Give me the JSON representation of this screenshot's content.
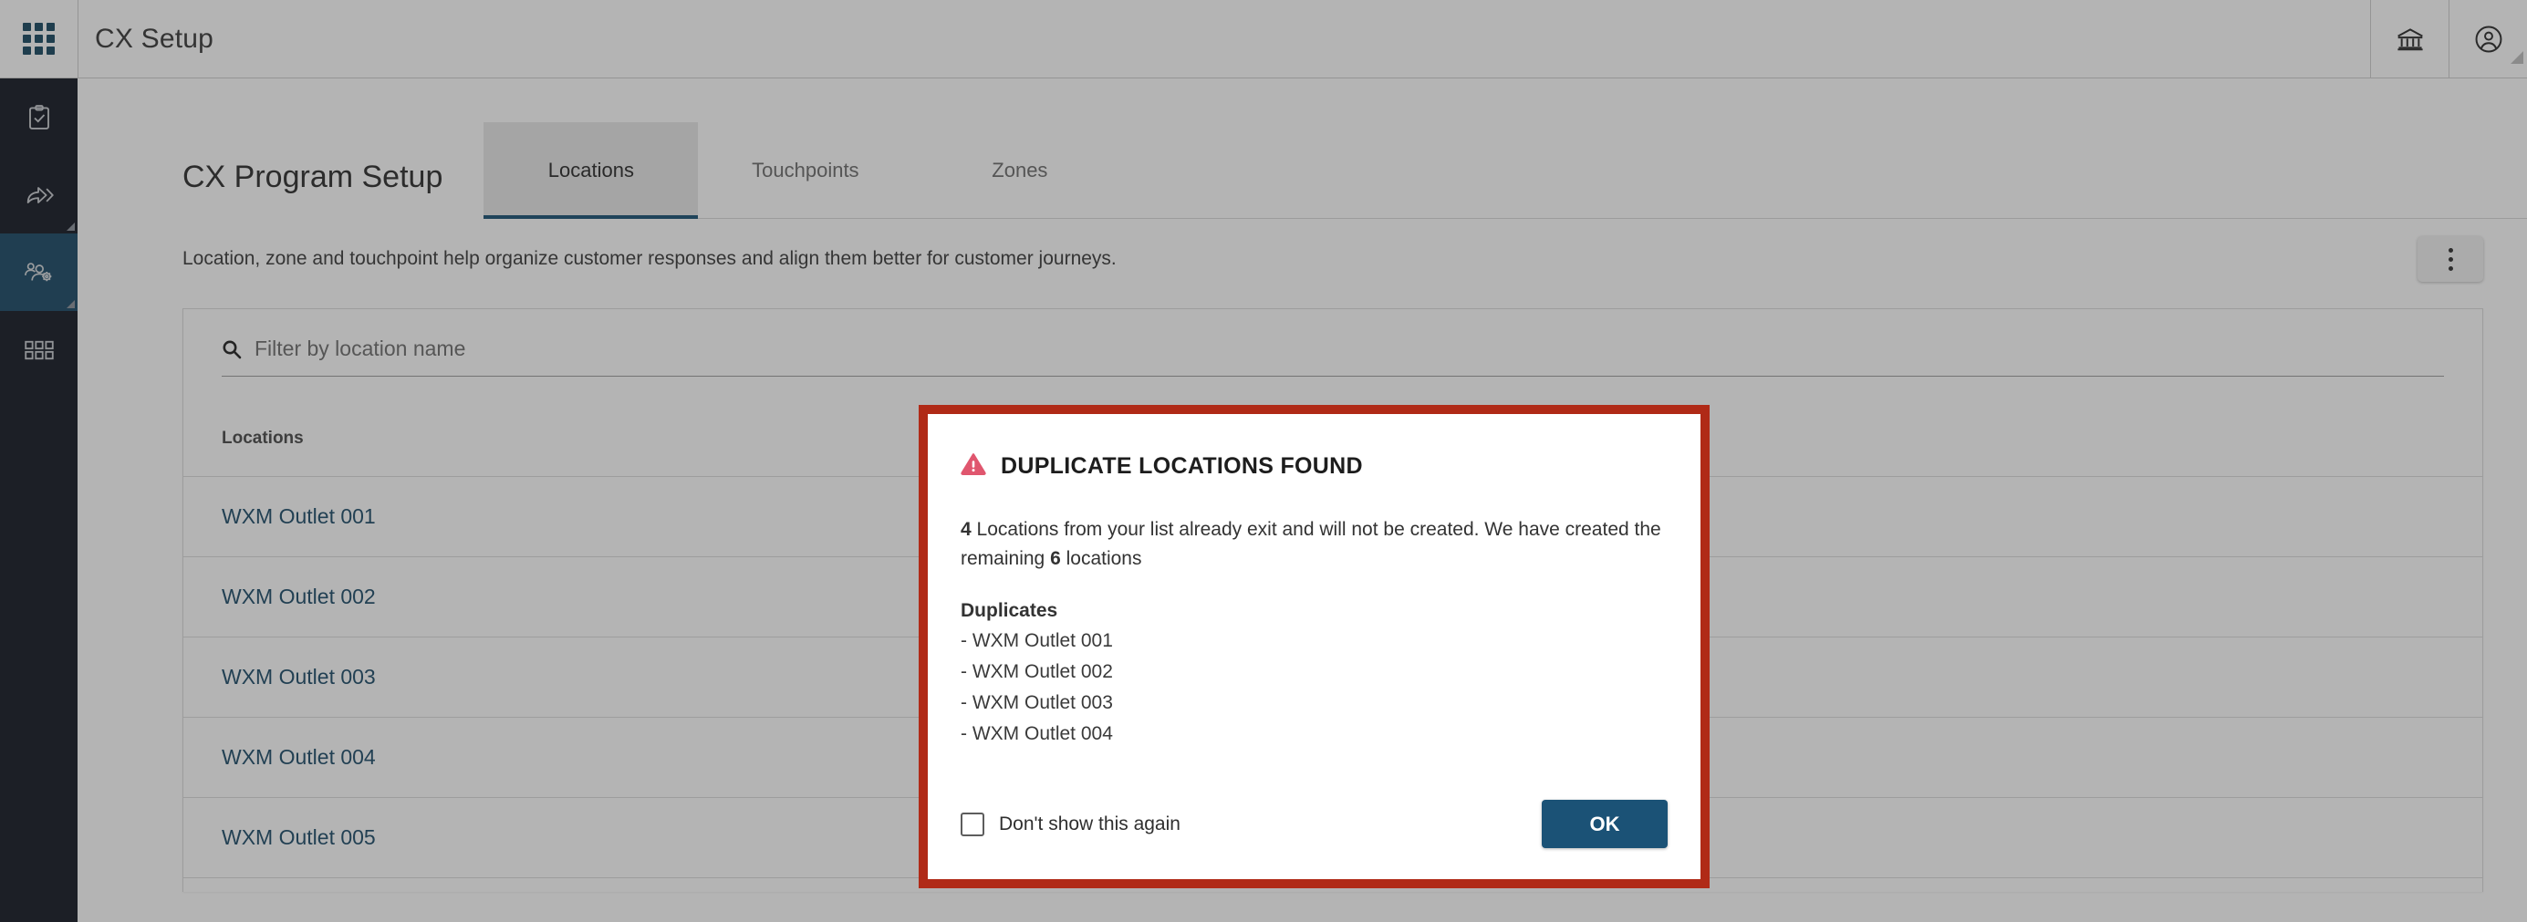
{
  "header": {
    "title": "CX Setup",
    "waffle_icon": "apps-grid-icon",
    "institution_icon": "bank-icon",
    "account_icon": "user-account-icon"
  },
  "sidebar": {
    "items": [
      {
        "id": "surveys",
        "icon": "clipboard-check-icon",
        "active": false,
        "has_flag": false
      },
      {
        "id": "dispatch",
        "icon": "share-arrow-icon",
        "active": false,
        "has_flag": true
      },
      {
        "id": "cx-setup",
        "icon": "users-gear-icon",
        "active": true,
        "has_flag": true
      },
      {
        "id": "modules",
        "icon": "grid-squares-icon",
        "active": false,
        "has_flag": false
      }
    ]
  },
  "page": {
    "title": "CX Program Setup",
    "description": "Location, zone and touchpoint help organize customer responses and align them better for customer journeys.",
    "kebab_icon": "more-vertical-icon",
    "tabs": [
      {
        "label": "Locations",
        "active": true
      },
      {
        "label": "Touchpoints",
        "active": false
      },
      {
        "label": "Zones",
        "active": false
      }
    ]
  },
  "search": {
    "icon": "search-icon",
    "value": "",
    "placeholder": "Filter by location name"
  },
  "table": {
    "columns": [
      "Locations"
    ],
    "rows": [
      {
        "name": "WXM Outlet 001"
      },
      {
        "name": "WXM Outlet 002"
      },
      {
        "name": "WXM Outlet 003"
      },
      {
        "name": "WXM Outlet 004"
      },
      {
        "name": "WXM Outlet 005"
      }
    ]
  },
  "modal": {
    "icon": "warning-triangle-icon",
    "title": "DUPLICATE LOCATIONS FOUND",
    "duplicate_count": "4",
    "created_count": "6",
    "message_part1": "Locations from your list already exit and will not be created. We have created the remaining",
    "message_part2": "locations",
    "duplicates_heading": "Duplicates",
    "duplicates": [
      "- WXM Outlet 001",
      "- WXM Outlet 002",
      "- WXM Outlet 003",
      "- WXM Outlet 004"
    ],
    "dont_show_label": "Don't show this again",
    "dont_show_checked": false,
    "ok_label": "OK"
  },
  "colors": {
    "modal_border": "#b02a17",
    "warning": "#e0566e",
    "accent_blue": "#1b5276",
    "link_blue": "#1f4e6b",
    "sidebar_bg": "#161b26",
    "sidebar_active": "#1d4a68"
  }
}
